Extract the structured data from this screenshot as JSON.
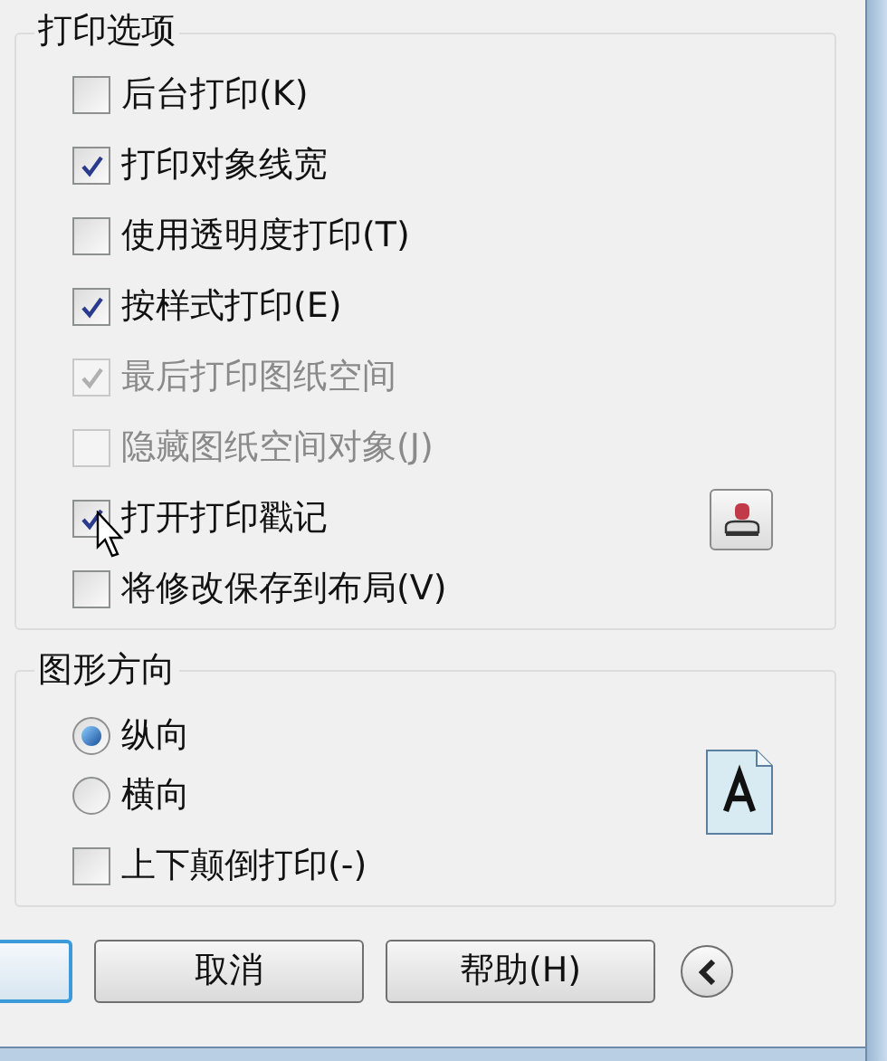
{
  "print_options": {
    "title": "打印选项",
    "items": [
      {
        "label": "后台打印(K)",
        "checked": false,
        "disabled": false,
        "side_button": false
      },
      {
        "label": "打印对象线宽",
        "checked": true,
        "disabled": false,
        "side_button": false
      },
      {
        "label": "使用透明度打印(T)",
        "checked": false,
        "disabled": false,
        "side_button": false
      },
      {
        "label": "按样式打印(E)",
        "checked": true,
        "disabled": false,
        "side_button": false
      },
      {
        "label": "最后打印图纸空间",
        "checked": true,
        "disabled": true,
        "side_button": false
      },
      {
        "label": "隐藏图纸空间对象(J)",
        "checked": false,
        "disabled": true,
        "side_button": false
      },
      {
        "label": "打开打印戳记",
        "checked": true,
        "disabled": false,
        "side_button": true
      },
      {
        "label": "将修改保存到布局(V)",
        "checked": false,
        "disabled": false,
        "side_button": false
      }
    ]
  },
  "orientation": {
    "title": "图形方向",
    "items": [
      {
        "kind": "radio",
        "label": "纵向",
        "selected": true
      },
      {
        "kind": "radio",
        "label": "横向",
        "selected": false
      },
      {
        "kind": "checkbox",
        "label": "上下颠倒打印(-)",
        "checked": false
      }
    ]
  },
  "buttons": [
    {
      "label": "取消"
    },
    {
      "label": "帮助(H)"
    }
  ]
}
